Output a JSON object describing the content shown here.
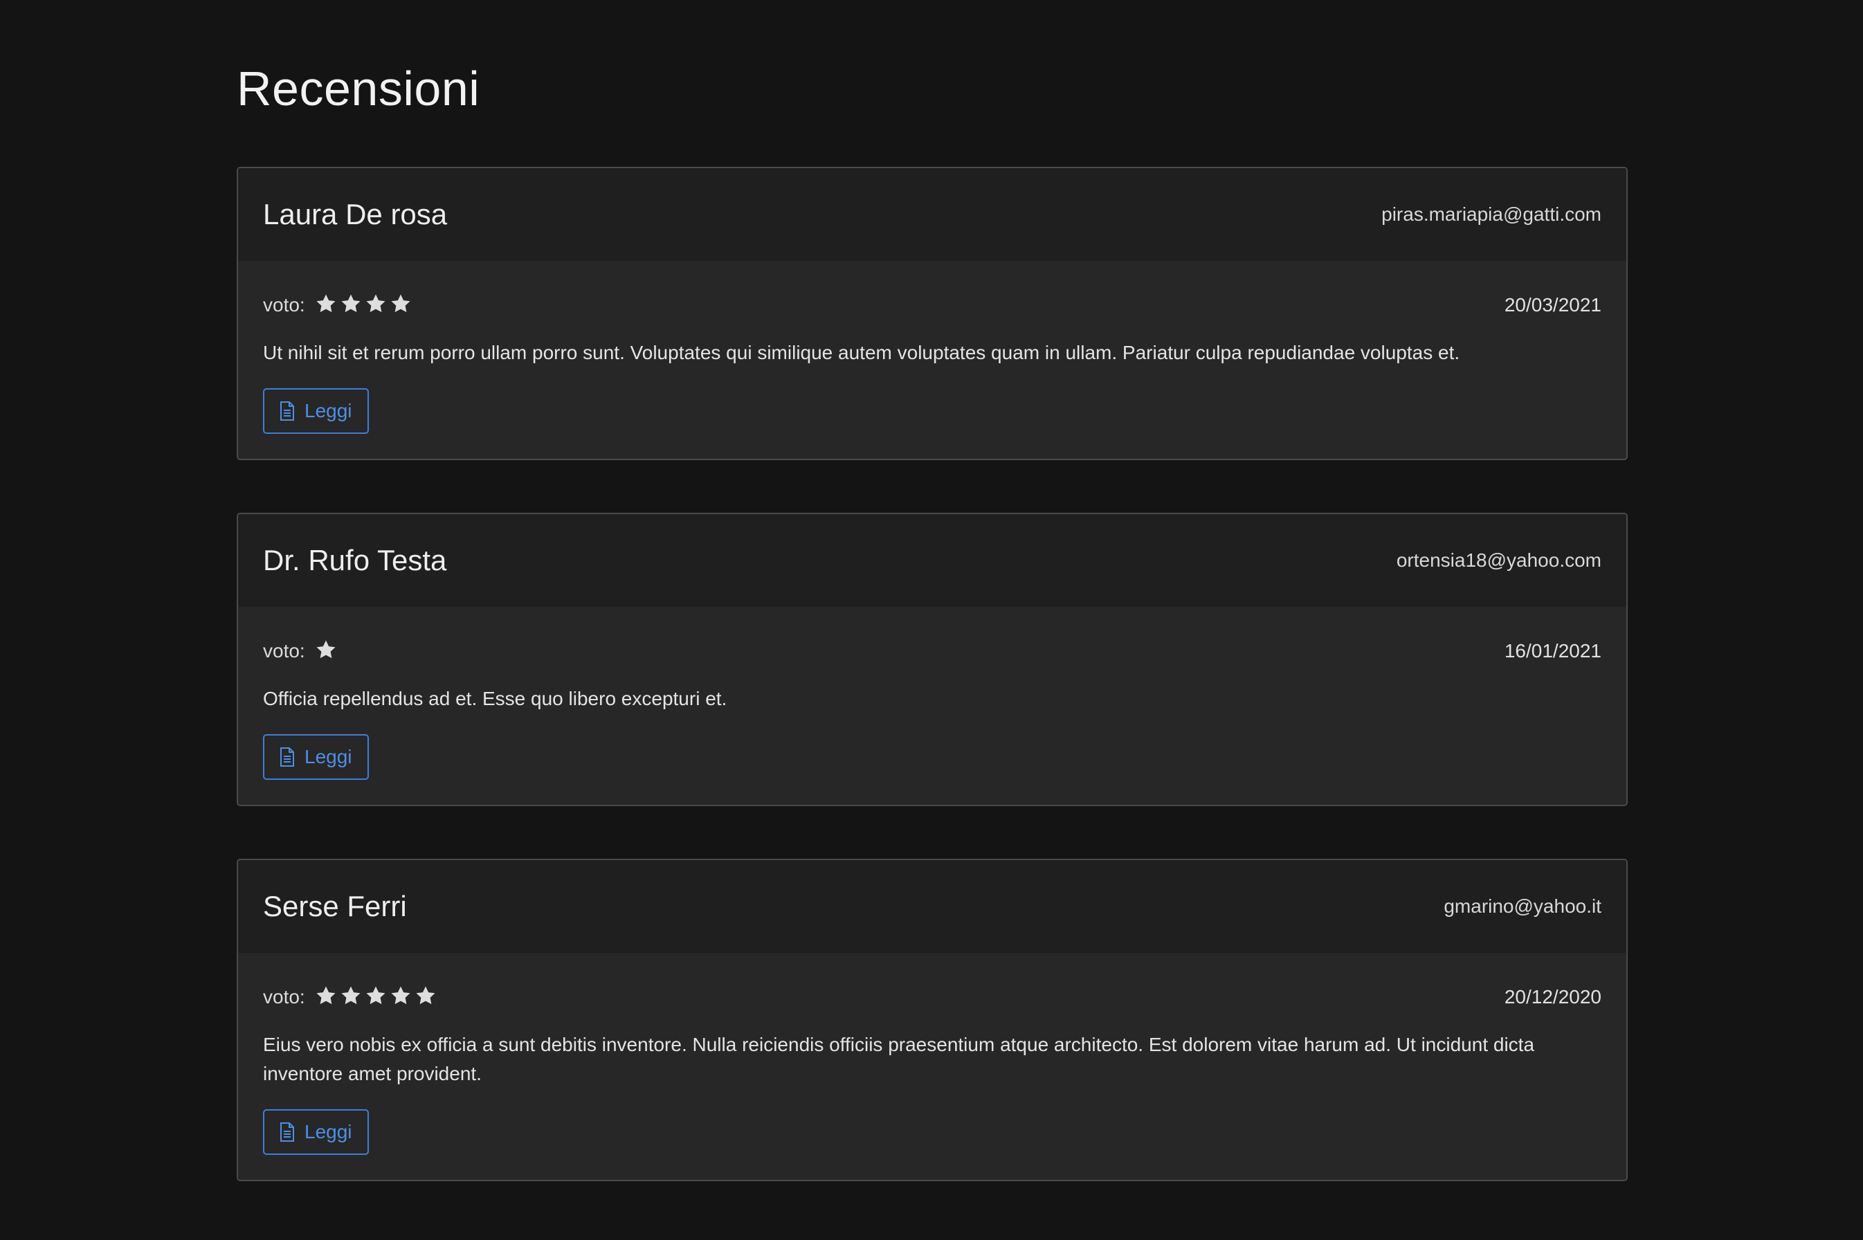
{
  "page": {
    "title": "Recensioni"
  },
  "colors": {
    "background": "#141414",
    "card_header": "#1f1f1f",
    "card_body": "#272727",
    "accent": "#4d8fe6"
  },
  "reviews": [
    {
      "name": "Laura De rosa",
      "email": "piras.mariapia@gatti.com",
      "rating_label": "voto:",
      "rating": 4,
      "date": "20/03/2021",
      "text": "Ut nihil sit et rerum porro ullam porro sunt. Voluptates qui similique autem voluptates quam in ullam. Pariatur culpa repudiandae voluptas et.",
      "button_label": "Leggi",
      "button_icon": "file-text-icon"
    },
    {
      "name": "Dr. Rufo Testa",
      "email": "ortensia18@yahoo.com",
      "rating_label": "voto:",
      "rating": 1,
      "date": "16/01/2021",
      "text": "Officia repellendus ad et. Esse quo libero excepturi et.",
      "button_label": "Leggi",
      "button_icon": "file-text-icon"
    },
    {
      "name": "Serse Ferri",
      "email": "gmarino@yahoo.it",
      "rating_label": "voto:",
      "rating": 5,
      "date": "20/12/2020",
      "text": "Eius vero nobis ex officia a sunt debitis inventore. Nulla reiciendis officiis praesentium atque architecto. Est dolorem vitae harum ad. Ut incidunt dicta inventore amet provident.",
      "button_label": "Leggi",
      "button_icon": "file-text-icon"
    }
  ]
}
